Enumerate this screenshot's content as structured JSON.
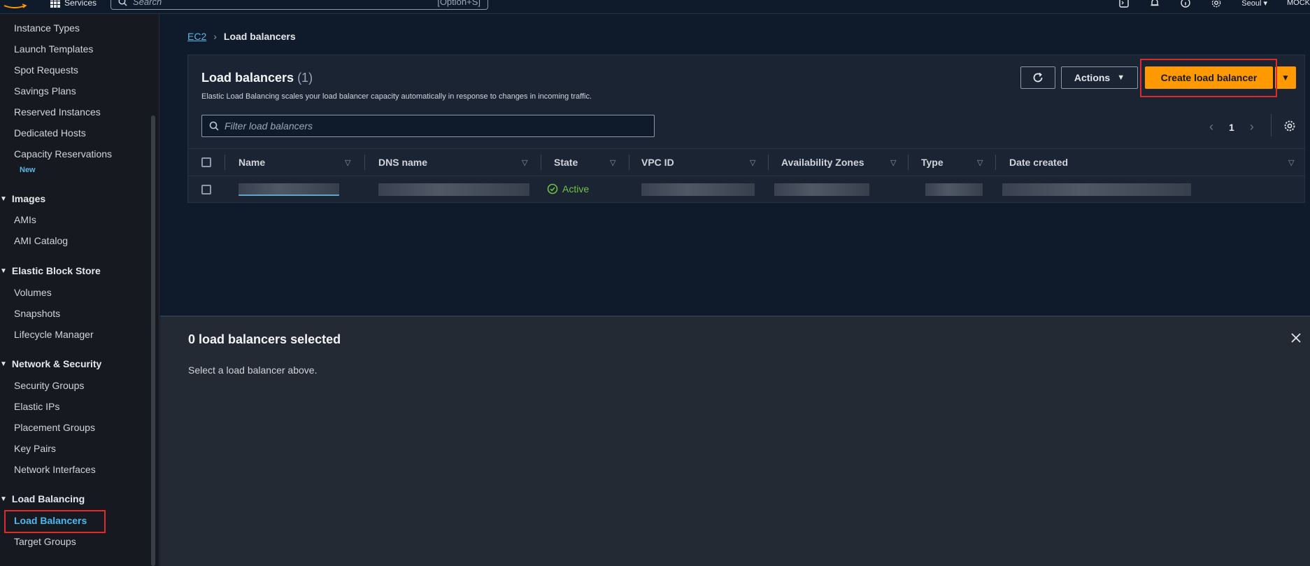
{
  "topnav": {
    "services_label": "Services",
    "search_placeholder": "Search",
    "search_hint": "[Option+S]",
    "region": "Seoul ▾",
    "account": "MOCK"
  },
  "sidebar": {
    "items": [
      {
        "label": "Instance Types"
      },
      {
        "label": "Launch Templates"
      },
      {
        "label": "Spot Requests"
      },
      {
        "label": "Savings Plans"
      },
      {
        "label": "Reserved Instances"
      },
      {
        "label": "Dedicated Hosts"
      },
      {
        "label": "Capacity Reservations"
      }
    ],
    "new_badge": "New",
    "sections": [
      {
        "title": "Images",
        "items": [
          "AMIs",
          "AMI Catalog"
        ]
      },
      {
        "title": "Elastic Block Store",
        "items": [
          "Volumes",
          "Snapshots",
          "Lifecycle Manager"
        ]
      },
      {
        "title": "Network & Security",
        "items": [
          "Security Groups",
          "Elastic IPs",
          "Placement Groups",
          "Key Pairs",
          "Network Interfaces"
        ]
      },
      {
        "title": "Load Balancing",
        "items": [
          "Load Balancers",
          "Target Groups"
        ]
      }
    ]
  },
  "breadcrumb": {
    "root": "EC2",
    "current": "Load balancers"
  },
  "panel": {
    "title": "Load balancers",
    "count": "(1)",
    "description": "Elastic Load Balancing scales your load balancer capacity automatically in response to changes in incoming traffic.",
    "actions_label": "Actions",
    "create_label": "Create load balancer",
    "filter_placeholder": "Filter load balancers",
    "page_number": "1"
  },
  "table": {
    "columns": [
      "Name",
      "DNS name",
      "State",
      "VPC ID",
      "Availability Zones",
      "Type",
      "Date created"
    ],
    "rows": [
      {
        "state": "Active"
      }
    ]
  },
  "detail": {
    "title": "0 load balancers selected",
    "message": "Select a load balancer above."
  },
  "colors": {
    "accent": "#ff9900",
    "link": "#5fb5e5",
    "active_green": "#6fc244",
    "highlight": "#e02b2b"
  }
}
